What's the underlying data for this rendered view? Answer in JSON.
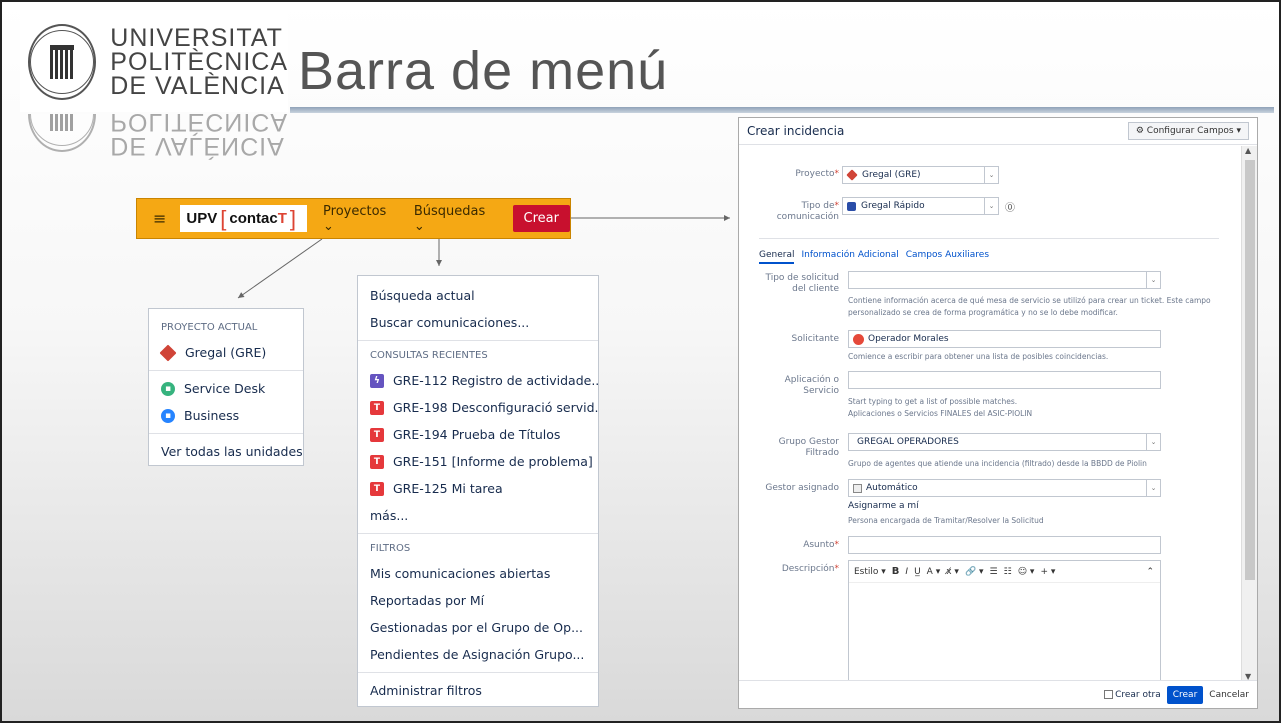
{
  "logo": {
    "line1": "UNIVERSITAT",
    "line2": "POLITÈCNICA",
    "line3": "DE VALÈNCIA"
  },
  "slide": {
    "title": "Barra de menú"
  },
  "navbar": {
    "brand_left": "UPV",
    "brand_right_a": "contac",
    "brand_right_b": "T",
    "proyectos": "Proyectos ⌄",
    "busquedas": "Búsquedas ⌄",
    "crear": "Crear"
  },
  "proyectos_menu": {
    "header": "PROYECTO ACTUAL",
    "items": [
      "Gregal (GRE)",
      "Service Desk",
      "Business"
    ],
    "all": "Ver todas las unidades"
  },
  "busquedas_menu": {
    "actual": "Búsqueda actual",
    "buscar": "Buscar comunicaciones...",
    "recientes_header": "CONSULTAS RECIENTES",
    "recientes": [
      "GRE-112 Registro de actividade...",
      "GRE-198 Desconfiguració servid...",
      "GRE-194 Prueba de Títulos",
      "GRE-151 [Informe de problema] ...",
      "GRE-125 Mi tarea"
    ],
    "mas": "más...",
    "filtros_header": "FILTROS",
    "filtros": [
      "Mis comunicaciones abiertas",
      "Reportadas por Mí",
      "Gestionadas por el Grupo de Op...",
      "Pendientes de Asignación Grupo..."
    ],
    "administrar": "Administrar filtros"
  },
  "dialog": {
    "title": "Crear incidencia",
    "configure": "⚙ Configurar Campos ▾",
    "proyecto_label": "Proyecto",
    "proyecto_value": "Gregal (GRE)",
    "tipo_label_1": "Tipo de",
    "tipo_label_2": "comunicación",
    "tipo_value": "Gregal Rápido",
    "tabs": [
      "General",
      "Información Adicional",
      "Campos Auxiliares"
    ],
    "tipo_solicitud_label_1": "Tipo de solicitud",
    "tipo_solicitud_label_2": "del cliente",
    "tipo_solicitud_help_1": "Contiene información acerca de qué mesa de servicio se utilizó para crear un ticket. Este campo",
    "tipo_solicitud_help_2": "personalizado se crea de forma programática y no se lo debe modificar.",
    "solicitante_label": "Solicitante",
    "solicitante_value": "Operador Morales",
    "solicitante_help": "Comience a escribir para obtener una lista de posibles coincidencias.",
    "aplicacion_label_1": "Aplicación o",
    "aplicacion_label_2": "Servicio",
    "aplicacion_help_1": "Start typing to get a list of possible matches.",
    "aplicacion_help_2": "Aplicaciones o Servicios FINALES del ASIC-PIOLIN",
    "grupo_label_1": "Grupo Gestor",
    "grupo_label_2": "Filtrado",
    "grupo_value": "GREGAL OPERADORES",
    "grupo_help": "Grupo de agentes que atiende una incidencia (filtrado) desde la BBDD de Piolin",
    "gestor_label": "Gestor asignado",
    "gestor_value": "Automático",
    "asignarme": "Asignarme a mí",
    "gestor_help": "Persona encargada de Tramitar/Resolver la Solicitud",
    "asunto_label": "Asunto",
    "descripcion_label": "Descripción",
    "toolbar": [
      "Estilo ▾",
      "B",
      "I",
      "U̲",
      "A ▾",
      "x̸ ▾",
      "🔗 ▾",
      "☰",
      "☷",
      "☺ ▾",
      "+ ▾",
      "⌃"
    ],
    "crear_otra": "Crear otra",
    "crear": "Crear",
    "cancelar": "Cancelar"
  }
}
